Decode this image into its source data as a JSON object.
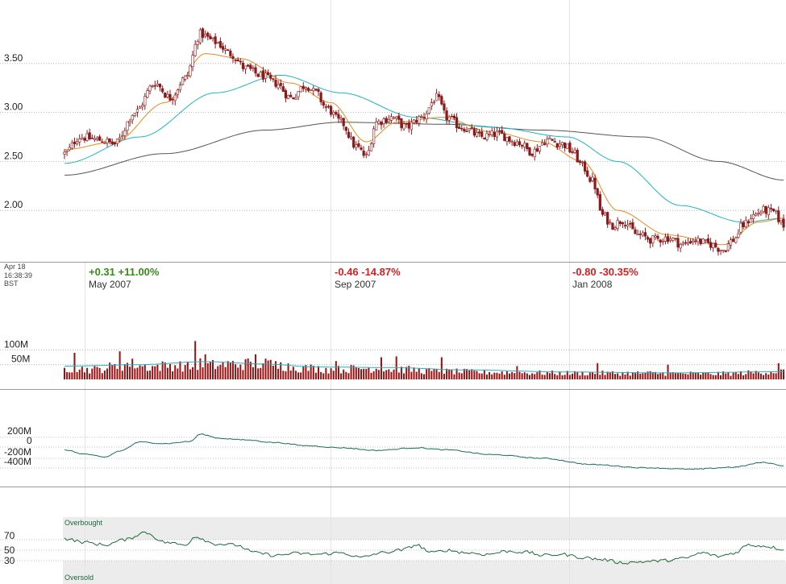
{
  "colors": {
    "up": "#ffffff",
    "down": "#8b1a1a",
    "candle_outline": "#8b1a1a",
    "ma_short": "#e8891c",
    "ma_mid": "#1fb5c4",
    "ma_long": "#555555",
    "volume_bar": "#9a1010",
    "volume_ma": "#1fb5c4",
    "obv_line": "#1a6b5a",
    "rsi_line": "#1a6b3a",
    "rsi_band": "#ececec",
    "change_up": "#3a8a1a",
    "change_down": "#d42020"
  },
  "timestamp": {
    "date": "Apr 18",
    "time": "16:38:39",
    "zone": "BST"
  },
  "period_changes": [
    {
      "text": "+0.31 +11.00%",
      "direction": "up",
      "month": "May 2007"
    },
    {
      "text": "-0.46 -14.87%",
      "direction": "down",
      "month": "Sep 2007"
    },
    {
      "text": "-0.80 -30.35%",
      "direction": "down",
      "month": "Jan 2008"
    }
  ],
  "rsi_labels": {
    "overbought": "Overbought",
    "oversold": "Oversold"
  },
  "chart_data": [
    {
      "type": "candlestick",
      "panel": "price",
      "y_ticks": [
        "2.00",
        "2.50",
        "3.00",
        "3.50"
      ],
      "ylim": [
        1.5,
        4.0
      ],
      "x_labels": [
        "May 2007",
        "Sep 2007",
        "Jan 2008"
      ],
      "close_anchors": [
        [
          0,
          2.58
        ],
        [
          6,
          2.75
        ],
        [
          14,
          2.72
        ],
        [
          20,
          2.68
        ],
        [
          28,
          3.0
        ],
        [
          36,
          3.3
        ],
        [
          42,
          3.15
        ],
        [
          48,
          3.35
        ],
        [
          54,
          3.8
        ],
        [
          60,
          3.72
        ],
        [
          66,
          3.6
        ],
        [
          72,
          3.45
        ],
        [
          78,
          3.38
        ],
        [
          84,
          3.3
        ],
        [
          90,
          3.15
        ],
        [
          96,
          3.28
        ],
        [
          100,
          3.2
        ],
        [
          104,
          3.05
        ],
        [
          110,
          2.9
        ],
        [
          116,
          2.65
        ],
        [
          120,
          2.55
        ],
        [
          124,
          2.9
        ],
        [
          130,
          2.95
        ],
        [
          136,
          2.85
        ],
        [
          142,
          2.95
        ],
        [
          148,
          3.15
        ],
        [
          152,
          2.95
        ],
        [
          158,
          2.85
        ],
        [
          166,
          2.75
        ],
        [
          172,
          2.78
        ],
        [
          180,
          2.7
        ],
        [
          186,
          2.6
        ],
        [
          192,
          2.72
        ],
        [
          198,
          2.68
        ],
        [
          202,
          2.6
        ],
        [
          206,
          2.45
        ],
        [
          210,
          2.3
        ],
        [
          214,
          1.95
        ],
        [
          218,
          1.85
        ],
        [
          222,
          1.9
        ],
        [
          228,
          1.75
        ],
        [
          234,
          1.7
        ],
        [
          240,
          1.72
        ],
        [
          246,
          1.65
        ],
        [
          250,
          1.7
        ],
        [
          256,
          1.66
        ],
        [
          262,
          1.6
        ],
        [
          266,
          1.7
        ],
        [
          270,
          1.85
        ],
        [
          274,
          1.95
        ],
        [
          278,
          2.0
        ],
        [
          282,
          1.98
        ],
        [
          286,
          1.85
        ]
      ],
      "sma20_anchors": [
        [
          0,
          2.62
        ],
        [
          20,
          2.7
        ],
        [
          40,
          3.1
        ],
        [
          56,
          3.6
        ],
        [
          70,
          3.55
        ],
        [
          90,
          3.3
        ],
        [
          106,
          3.1
        ],
        [
          120,
          2.7
        ],
        [
          132,
          2.9
        ],
        [
          150,
          2.95
        ],
        [
          170,
          2.8
        ],
        [
          190,
          2.7
        ],
        [
          206,
          2.5
        ],
        [
          220,
          2.0
        ],
        [
          240,
          1.75
        ],
        [
          262,
          1.65
        ],
        [
          276,
          1.88
        ],
        [
          286,
          1.92
        ]
      ],
      "sma50_anchors": [
        [
          0,
          2.48
        ],
        [
          30,
          2.75
        ],
        [
          60,
          3.2
        ],
        [
          86,
          3.38
        ],
        [
          110,
          3.2
        ],
        [
          140,
          2.95
        ],
        [
          170,
          2.85
        ],
        [
          200,
          2.75
        ],
        [
          220,
          2.5
        ],
        [
          245,
          2.05
        ],
        [
          270,
          1.88
        ],
        [
          286,
          1.92
        ]
      ],
      "sma200_anchors": [
        [
          0,
          2.36
        ],
        [
          40,
          2.58
        ],
        [
          80,
          2.82
        ],
        [
          110,
          2.9
        ],
        [
          150,
          2.88
        ],
        [
          190,
          2.82
        ],
        [
          230,
          2.75
        ],
        [
          260,
          2.5
        ],
        [
          286,
          2.31
        ]
      ],
      "series": [
        {
          "values": []
        },
        {
          "values": []
        },
        {
          "values": []
        },
        {
          "values": []
        }
      ]
    },
    {
      "type": "bar",
      "panel": "volume",
      "y_ticks": [
        "50M",
        "100M"
      ],
      "ylim": [
        0,
        180
      ],
      "volume_anchors": [
        [
          0,
          40
        ],
        [
          12,
          35
        ],
        [
          20,
          45
        ],
        [
          26,
          55
        ],
        [
          34,
          45
        ],
        [
          44,
          50
        ],
        [
          50,
          45
        ],
        [
          54,
          55
        ],
        [
          58,
          50
        ],
        [
          70,
          55
        ],
        [
          80,
          55
        ],
        [
          96,
          40
        ],
        [
          108,
          35
        ],
        [
          120,
          40
        ],
        [
          134,
          35
        ],
        [
          150,
          28
        ],
        [
          170,
          25
        ],
        [
          200,
          22
        ],
        [
          230,
          22
        ],
        [
          260,
          20
        ],
        [
          286,
          28
        ]
      ],
      "volume_spikes": [
        [
          4,
          90
        ],
        [
          22,
          95
        ],
        [
          52,
          130
        ],
        [
          56,
          85
        ],
        [
          76,
          85
        ],
        [
          86,
          58
        ],
        [
          108,
          62
        ],
        [
          126,
          75
        ],
        [
          132,
          78
        ],
        [
          150,
          75
        ],
        [
          180,
          45
        ],
        [
          212,
          55
        ],
        [
          240,
          50
        ],
        [
          284,
          55
        ]
      ],
      "volume_ma_anchors": [
        [
          0,
          45
        ],
        [
          30,
          50
        ],
        [
          56,
          60
        ],
        [
          80,
          52
        ],
        [
          100,
          42
        ],
        [
          130,
          40
        ],
        [
          160,
          32
        ],
        [
          200,
          25
        ],
        [
          240,
          22
        ],
        [
          286,
          26
        ]
      ]
    },
    {
      "type": "line",
      "panel": "obv",
      "y_ticks": [
        "0",
        "-200M",
        "-400M"
      ],
      "ylim": [
        -620,
        300
      ],
      "obv_anchors": [
        [
          0,
          -100
        ],
        [
          8,
          -180
        ],
        [
          16,
          -240
        ],
        [
          22,
          -120
        ],
        [
          30,
          50
        ],
        [
          40,
          20
        ],
        [
          50,
          60
        ],
        [
          54,
          200
        ],
        [
          62,
          120
        ],
        [
          72,
          90
        ],
        [
          84,
          40
        ],
        [
          96,
          -20
        ],
        [
          110,
          -60
        ],
        [
          124,
          -110
        ],
        [
          140,
          -60
        ],
        [
          152,
          -100
        ],
        [
          170,
          -190
        ],
        [
          190,
          -260
        ],
        [
          210,
          -380
        ],
        [
          230,
          -440
        ],
        [
          250,
          -470
        ],
        [
          266,
          -430
        ],
        [
          278,
          -340
        ],
        [
          286,
          -400
        ]
      ]
    },
    {
      "type": "line",
      "panel": "rsi",
      "y_ticks": [
        "70",
        "50",
        "30"
      ],
      "ylim": [
        12,
        100
      ],
      "rsi_anchors": [
        [
          0,
          72
        ],
        [
          8,
          65
        ],
        [
          16,
          60
        ],
        [
          24,
          70
        ],
        [
          32,
          84
        ],
        [
          40,
          65
        ],
        [
          48,
          60
        ],
        [
          52,
          76
        ],
        [
          60,
          62
        ],
        [
          68,
          60
        ],
        [
          76,
          45
        ],
        [
          84,
          40
        ],
        [
          92,
          44
        ],
        [
          100,
          42
        ],
        [
          110,
          45
        ],
        [
          118,
          36
        ],
        [
          126,
          45
        ],
        [
          134,
          50
        ],
        [
          140,
          60
        ],
        [
          146,
          45
        ],
        [
          152,
          50
        ],
        [
          160,
          45
        ],
        [
          168,
          42
        ],
        [
          176,
          48
        ],
        [
          184,
          46
        ],
        [
          190,
          40
        ],
        [
          198,
          42
        ],
        [
          206,
          36
        ],
        [
          214,
          32
        ],
        [
          222,
          26
        ],
        [
          230,
          28
        ],
        [
          238,
          30
        ],
        [
          246,
          34
        ],
        [
          254,
          45
        ],
        [
          260,
          38
        ],
        [
          266,
          44
        ],
        [
          272,
          60
        ],
        [
          278,
          58
        ],
        [
          286,
          52
        ]
      ]
    }
  ]
}
